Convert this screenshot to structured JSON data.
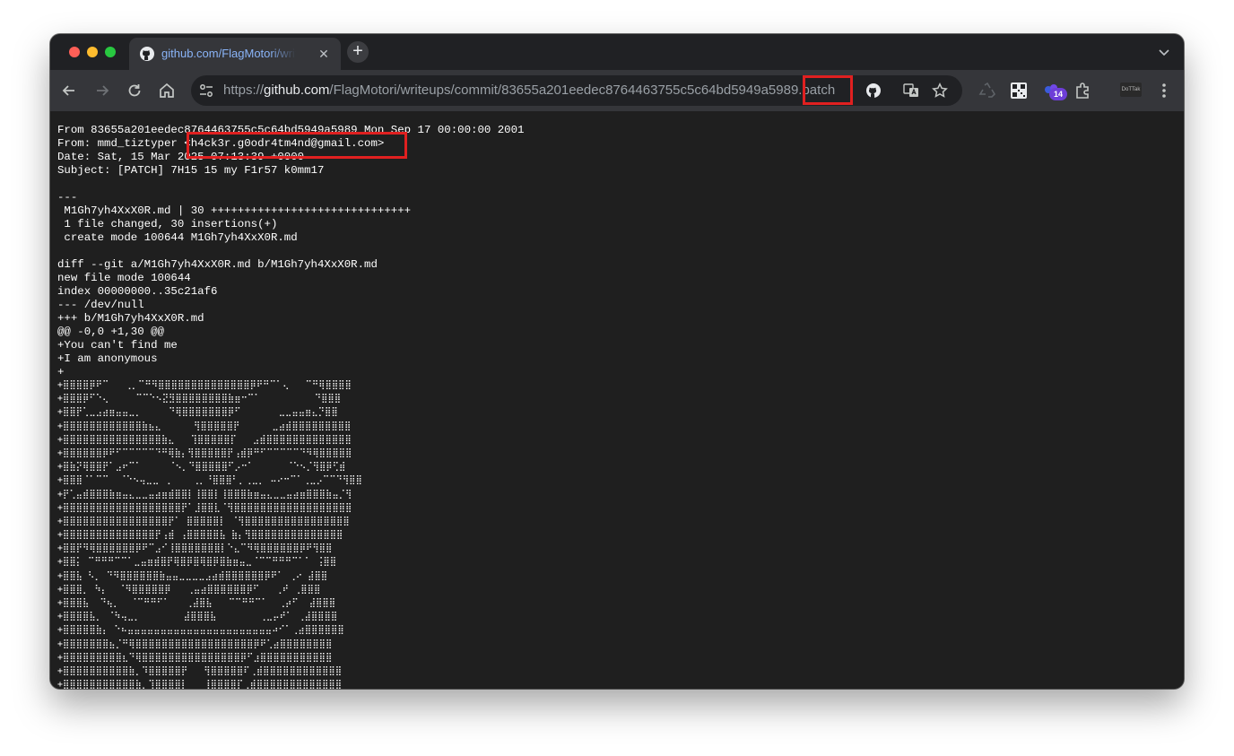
{
  "tab": {
    "title": "github.com/FlagMotori/writeups",
    "icon": "github-icon"
  },
  "omnibox": {
    "scheme": "https://",
    "host": "github.com",
    "path": "/FlagMotori/writeups/commit/83655a201eedec8764463755c5c64bd5949a598",
    "partial_char": "9",
    "extension": ".patch"
  },
  "extensions": {
    "badge_count": "14",
    "avatar_label": "DoTTak"
  },
  "patch": {
    "line1": "From 83655a201eedec8764463755c5c64bd5949a5989 Mon Sep 17 00:00:00 2001",
    "from_name": "From: mmd_tiztyper ",
    "from_email": "<h4ck3r.g0odr4tm4nd@gmail.com>",
    "date": "Date: Sat, 15 Mar 2025 07:13:39 +0000",
    "subject": "Subject: [PATCH] 7H15 15 my F1r57 k0mm17",
    "sep": "---",
    "stat1": " M1Gh7yh4XxX0R.md | 30 ++++++++++++++++++++++++++++++",
    "stat2": " 1 file changed, 30 insertions(+)",
    "stat3": " create mode 100644 M1Gh7yh4XxX0R.md",
    "diff1": "diff --git a/M1Gh7yh4XxX0R.md b/M1Gh7yh4XxX0R.md",
    "diff2": "new file mode 100644",
    "diff3": "index 00000000..35c21af6",
    "diff4": "--- /dev/null",
    "diff5": "+++ b/M1Gh7yh4XxX0R.md",
    "hunk": "@@ -0,0 +1,30 @@",
    "add1": "+You can't find me",
    "add2": "+I am anonymous",
    "add3": "+"
  },
  "ascii_art": [
    "+⣿⣿⣿⣿⡿⠟⠉   ⢀⡀⠉⠛⠻⣿⣿⣿⣿⣿⣿⣿⣿⣿⣿⣿⣿⣿⣿⡿⠟⠛⠉⠁⢄   ⠉⠛⢿⣿⣿⣿⣿",
    "+⣿⣿⣿⡿⠋⠑⢄     ⠉⠉⠑⠢⣝⣻⣿⣿⣿⣿⣿⣿⣿⣿⣷⣶⠒⠉⠁          ⠙⣿⣿⣿",
    "+⣿⣿⡟⢁⣀⣠⣴⣶⣤⣤⣀⡀     ⠙⢿⣿⣿⣿⣿⣿⣿⣿⡿⠋       ⣀⣀⣤⣤⣶⣄⡙⣿⣿",
    "+⣿⣿⣿⣿⣿⣿⣿⣿⣿⣿⣿⣿⣷⣦⣄      ⢻⣿⣿⣿⣿⣿⡟      ⣀⣴⣾⣿⣿⣿⣿⣿⣿⣿⣿⣿",
    "+⣿⣿⣿⣿⣿⣿⣿⣿⣿⣿⣿⣿⣿⣿⣿⣷⣄   ⢹⣿⣿⣿⣿⣿⡏   ⣠⣾⣿⣿⣿⣿⣿⣿⣿⣿⣿⣿⣿⣿⣿",
    "+⣿⣿⣿⣿⣿⣿⡿⠟⠋⠉⠉⠉⠉⠉⠙⠛⢿⣷⡄⢻⣿⣿⣿⣿⣿⡟⢠⣾⡿⠛⠋⠉⠉⠉⠉⠉⠙⠻⢿⣿⣿⣿⣿⣿",
    "+⣿⣷⡝⢿⣿⣿⡟⠁⣠⠖⠉⠁     ⠈⠢⡀⠙⣿⣿⣿⣿⣿⠋⡠⠒⠁      ⠈⠑⠢⡈⢻⣿⡿⢋⣾",
    "+⣿⣿⣿⠈⠁⠉⠉  ⠈⠑⠢⢤⣀⣀ ⢀    ⢀⡀⠘⣿⣿⣿⠃⡀⢀⣀⡀ ⠤⠔⠒⠉⠁⢀⣀⡠⠉⠉⠙⢻⣿⣿",
    "+⡟⢁⣤⣾⣿⣿⣿⣷⣶⣤⣄⣀⣀⣤⣴⣶⣾⣿⣿⡇⢸⣿⣿⡇⢸⣿⣿⣿⣷⣶⣤⣄⣀⣀⣤⣴⣶⣿⣿⣿⣷⣤⡈⢻",
    "+⣿⣿⣿⣿⣿⣿⣿⣿⣿⣿⣿⣿⣿⣿⣿⣿⣿⣿⡟⠁⣸⣿⣿⣇⠈⢻⣿⣿⣿⣿⣿⣿⣿⣿⣿⣿⣿⣿⣿⣿⣿⣿⣿⣿",
    "+⣿⣿⣿⣿⣿⣿⣿⣿⣿⣿⣿⣿⣿⣿⣿⣿⡟⠁ ⣿⣿⣿⣿⣿⡇ ⠈⢻⣿⣿⣿⣿⣿⣿⣿⣿⣿⣿⣿⣿⣿⣿⣿⣿",
    "+⣿⣿⣿⣿⣿⣿⣿⣿⣿⣿⣿⣿⣿⣿⡟⢠⣾ ⢠⣿⣿⣿⣿⣿⣧ ⣷⡄⢻⣿⣿⣿⣿⣿⣿⣿⣿⣿⣿⣿⣿⣿⣿",
    "+⣿⣿⡟⠻⢿⣿⣿⣿⣿⣿⣿⡿⠟⠉⣠⠊⢸⣿⣿⣿⣿⣿⣿⣿⡇⠑⣄⠉⠻⢿⣿⣿⣿⣿⣿⣿⡿⠟⢻⣿⣿",
    "+⣿⣿⡅ ⠉⠛⠛⠛⠉⠉⠁⣀⣤⣶⣾⣿⡟⢿⣿⡿⣿⢿⣿⡿⣿⣷⣶⣤⣀⠈⠉⠉⠛⠛⠛⠉⠁⠁ ⢨⣿⣿",
    "+⣿⣿⣧ ⠣⡀ ⠙⠻⣿⣿⣿⣿⣿⣿⣷⣤⣤⣀⣀⣀⣀⣠⣴⣾⣿⣿⣿⣿⣿⣿⡿⠟⠁ ⢀⠔ ⣼⣿⣿",
    "+⣿⣿⣿⡀ ⠳⡄  ⠈⠻⣿⣿⣿⣿⣿⡿   ⢀⣤⣴⣿⣿⣿⣿⣿⣿⡿⠋   ⢀⠞ ⢀⣿⣿⣿",
    "+⣿⣿⣿⣧  ⠙⢦⡀  ⠈⠉⠛⠛⠋⠁   ⢀⣼⣿⣧   ⠉⠉⠛⠛⠉⠁  ⢀⡴⠋  ⣼⣿⣿⣿",
    "+⣿⣿⣿⣿⣧⡀ ⠈⠳⢤⣀⡀        ⣼⣿⣿⣿⣧        ⢀⣀⡤⠞⠁ ⢀⣼⣿⣿⣿⣿",
    "+⣿⣿⣿⣿⣿⣷⡄ ⠑⠦⣤⣤⣤⣤⣤⣤⣤⣤⣤⣤⣤⣤⣤⣤⣤⣤⣤⣤⣤⣤⣤⣤⠴⠊⠁⢀⣴⣿⣿⣿⣿⣿⣿",
    "+⣿⣿⣿⣿⣿⣿⣿⣦⡈⠛⢿⣿⣿⣿⣿⣿⣿⣿⣿⣿⣿⣿⣿⣿⣿⣿⣿⣿⣿⡿⠟⢁⣴⣿⣿⣿⣿⣿⣿⣿⣿",
    "+⣿⣿⣿⣿⣿⣿⣿⣿⣿⣆⠙⢿⣿⣿⣿⣿⣿⣿⣿⣿⣿⣿⣿⣿⣿⣿⣿⡿⠋⣰⣿⣿⣿⣿⣿⣿⣿⣿⣿⣿⣿",
    "+⣿⣿⣿⣿⣿⣿⣿⣿⣿⣿⣷⡀⠹⣿⣿⣿⣿⣿⡟   ⢻⣿⣿⣿⣿⣿⠏⢀⣾⣿⣿⣿⣿⣿⣿⣿⣿⣿⣿⣿⣿",
    "+⣿⣿⣿⣿⣿⣿⣿⣿⣿⣿⣿⣷⡀⢹⣿⣿⣿⣿⡇   ⢸⣿⣿⣿⣿⡏⢀⣾⣿⣿⣿⣿⣿⣿⣿⣿⣿⣿⣿⣿⣿"
  ]
}
